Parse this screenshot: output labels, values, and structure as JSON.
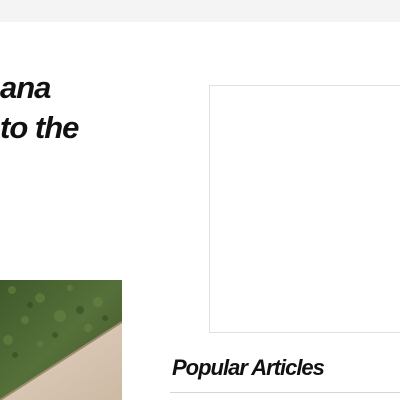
{
  "article": {
    "headline_line1": "ana",
    "headline_line2": "to the"
  },
  "sidebar": {
    "popular_title": "Popular Articles"
  },
  "colors": {
    "top_bar": "#f4f4f4",
    "headline": "#111111",
    "ad_border": "#e1e1e1",
    "grass": "#4f6a33",
    "pavement": "#d9c8b6",
    "rule": "#d4d4d4"
  }
}
